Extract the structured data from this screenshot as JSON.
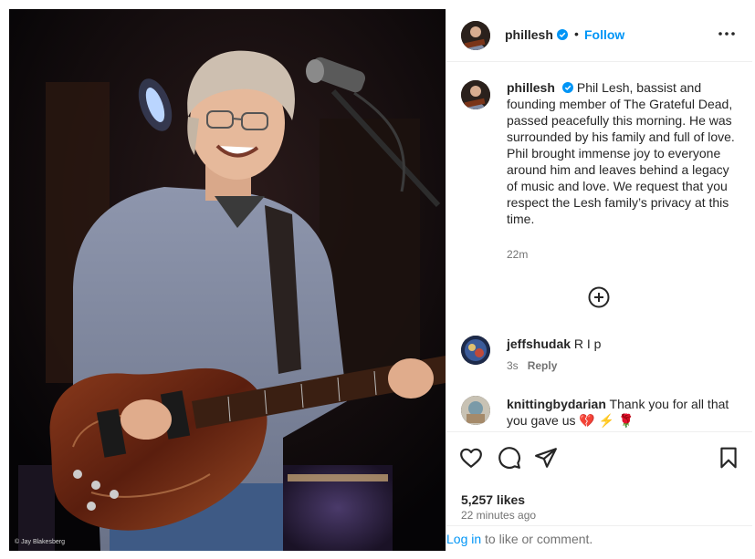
{
  "photo": {
    "credit": "© Jay Blakesberg"
  },
  "header": {
    "username": "phillesh",
    "verified_icon": "verified-badge-icon",
    "separator": "•",
    "follow_label": "Follow",
    "more_icon": "more-options-icon"
  },
  "caption": {
    "username": "phillesh",
    "text": "Phil Lesh, bassist and founding member of The Grateful Dead, passed peacefully this morning. He was surrounded by his family and full of love. Phil brought immense joy to everyone around him and leaves behind a legacy of music and love. We request that you respect the Lesh family’s privacy at this time.",
    "time": "22m"
  },
  "add_comment_icon": "plus-circle-icon",
  "comments": [
    {
      "username": "jeffshudak",
      "text": "R I p",
      "time": "3s",
      "reply_label": "Reply"
    },
    {
      "username": "knittingbydarian",
      "text": "Thank you for all that you gave us 💔 ⚡ 🌹"
    }
  ],
  "actions": {
    "like_icon": "heart-icon",
    "comment_icon": "comment-icon",
    "share_icon": "share-icon",
    "save_icon": "bookmark-icon"
  },
  "likes": "5,257 likes",
  "posted_ago": "22 minutes ago",
  "login": {
    "link_label": "Log in",
    "suffix": " to like or comment."
  },
  "colors": {
    "accent": "#0095f6",
    "text": "#262626",
    "muted": "#737373",
    "border": "#efefef"
  }
}
